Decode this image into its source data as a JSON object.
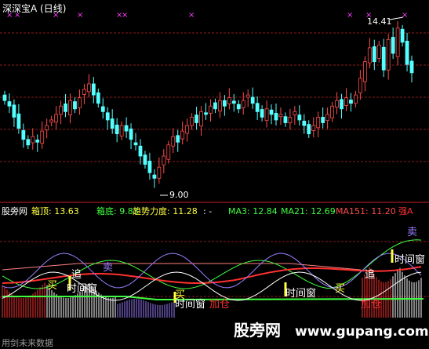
{
  "header": {
    "title": "深深宝A (日线)",
    "title_color": "#ffffff"
  },
  "colors": {
    "up": "#ff4d4d",
    "down": "#54ffff",
    "grid": "#8b1a1a",
    "magenta": "#ff40ff",
    "yellow": "#ffff40",
    "green": "#40ff40",
    "red": "#ff3030",
    "white": "#ffffff",
    "purple": "#9a7dff"
  },
  "price_panel": {
    "high_label": "14.41",
    "low_label": "9.00",
    "marks": [
      "×",
      "×",
      "×",
      "×",
      "×",
      "×",
      "×",
      "×",
      "×",
      "×"
    ]
  },
  "indicator_bar": {
    "site": "股旁网",
    "items": [
      {
        "label": "箱顶:",
        "value": "13.63",
        "color": "#ffff40"
      },
      {
        "label": "箱底:",
        "value": "9.83",
        "color": "#40ff40"
      },
      {
        "label": "趋势力度:",
        "value": "11.28",
        "color": "#ffff40"
      },
      {
        "label": ":",
        "value": "-",
        "color": "#ffffff"
      },
      {
        "label": "MA3:",
        "value": "12.84",
        "color": "#40ff40"
      },
      {
        "label": "MA21:",
        "value": "12.69",
        "color": "#40ff40"
      },
      {
        "label": "MA151:",
        "value": "11.20",
        "color": "#ff4d4d"
      },
      {
        "label": "强A",
        "value": "",
        "color": "#ff3030"
      }
    ]
  },
  "lower_panel": {
    "signals": [
      {
        "text": "买",
        "color": "#ffff40"
      },
      {
        "text": "追",
        "color": "#ffffff"
      },
      {
        "text": "卖",
        "color": "#9a7dff"
      },
      {
        "text": "时间窗",
        "color": "#ffffff"
      },
      {
        "text": "买",
        "color": "#ffff40"
      },
      {
        "text": "时间窗",
        "color": "#ffffff"
      },
      {
        "text": "加仓",
        "color": "#ff3030"
      },
      {
        "text": "时间窗",
        "color": "#ffffff"
      },
      {
        "text": "买",
        "color": "#ffff40"
      },
      {
        "text": "追",
        "color": "#ffffff"
      },
      {
        "text": "加仓",
        "color": "#ff3030"
      },
      {
        "text": "卖",
        "color": "#9a7dff"
      },
      {
        "text": "时间窗",
        "color": "#ffffff"
      }
    ],
    "footer": "用剑未来数据",
    "watermark_main": "股旁网",
    "watermark_url": "www.gupang.com"
  },
  "chart_data": [
    {
      "type": "candlestick",
      "title": "深深宝A (日线)",
      "series": [
        {
          "name": "close",
          "values": [
            11.8,
            11.6,
            11.2,
            10.8,
            10.4,
            10.2,
            10.5,
            10.3,
            10.7,
            10.9,
            11.1,
            11.3,
            11.6,
            11.4,
            11.8,
            11.5,
            11.9,
            12.2,
            12.4,
            12.0,
            11.7,
            11.4,
            11.1,
            10.8,
            10.6,
            10.9,
            10.7,
            10.4,
            10.2,
            9.8,
            9.5,
            9.2,
            9.0,
            9.4,
            9.8,
            10.2,
            10.5,
            10.3,
            10.7,
            10.9,
            11.2,
            11.0,
            11.4,
            11.3,
            11.6,
            11.5,
            11.8,
            11.6,
            11.9,
            11.7,
            11.5,
            11.8,
            12.0,
            11.7,
            11.4,
            11.2,
            11.5,
            11.3,
            11.1,
            11.3,
            11.0,
            11.2,
            11.4,
            11.1,
            10.9,
            10.6,
            10.9,
            11.2,
            11.0,
            11.3,
            11.6,
            11.8,
            11.5,
            11.9,
            11.7,
            12.0,
            12.6,
            13.2,
            13.7,
            13.2,
            13.8,
            12.9,
            14.0,
            13.5,
            14.41,
            13.9,
            13.1,
            12.8
          ]
        }
      ],
      "ylim": [
        8.5,
        14.8
      ],
      "annotations": [
        "14.41",
        "9.00"
      ]
    },
    {
      "type": "line",
      "series": [
        {
          "name": "箱顶",
          "values": [
            13.63
          ]
        },
        {
          "name": "箱底",
          "values": [
            9.83
          ]
        },
        {
          "name": "趋势力度",
          "values": [
            11.28
          ]
        },
        {
          "name": "MA3",
          "values": [
            12.84
          ]
        },
        {
          "name": "MA21",
          "values": [
            12.69
          ]
        },
        {
          "name": "MA151",
          "values": [
            11.2
          ]
        }
      ]
    }
  ]
}
